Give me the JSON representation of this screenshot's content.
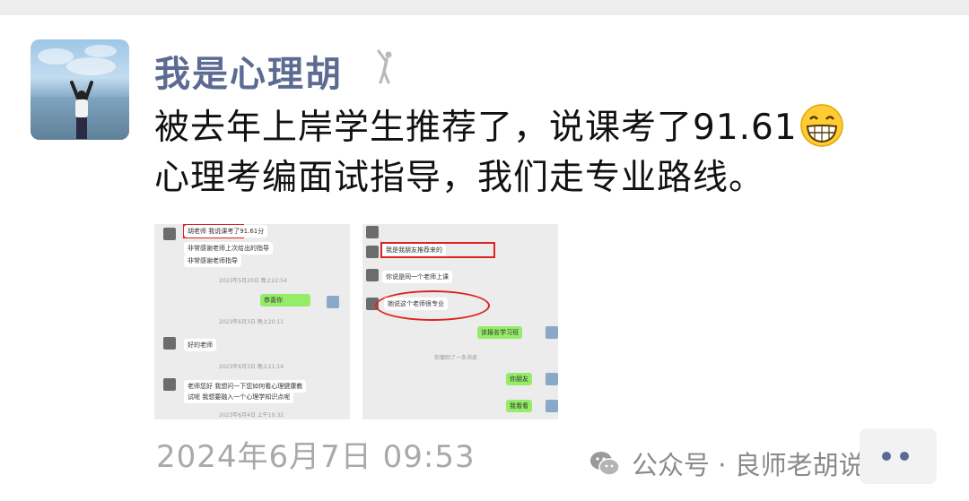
{
  "post": {
    "author_name": "我是心理胡",
    "author_badge_icon": "person-cheering-icon",
    "text_line1": "被去年上岸学生推荐了，说课考了91.61",
    "emoji": "grinning-face-emoji",
    "text_line2": "心理考编面试指导，我们走专业路线。",
    "timestamp": "2024年6月7日 09:53",
    "more_icon": "more-dots-icon"
  },
  "images": [
    {
      "name": "chat-screenshot-1",
      "messages": [
        {
          "side": "left",
          "text": "胡老师 我说课考了91.61分",
          "highlight": "box"
        },
        {
          "side": "left",
          "text": "非常感谢老师上次给出的指导"
        },
        {
          "side": "left",
          "text": "非常感谢老师指导"
        },
        {
          "side": "time",
          "text": "2023年5月20日 晚上22:54"
        },
        {
          "side": "right",
          "text": "恭喜你"
        },
        {
          "side": "time",
          "text": "2023年6月3日 晚上20:11"
        },
        {
          "side": "left",
          "text": "好的老师"
        },
        {
          "side": "time",
          "text": "2023年6月3日 晚上21:14"
        },
        {
          "side": "left",
          "text": "老师您好 我想问一下您如何看心理健康教"
        },
        {
          "side": "left",
          "text": "试呢 我想要融入一个心理学知识点呢"
        },
        {
          "side": "time",
          "text": "2023年6月4日 上午10:32"
        }
      ]
    },
    {
      "name": "chat-screenshot-2",
      "messages": [
        {
          "side": "left",
          "text": "我是我朋友推荐来的",
          "highlight": "box"
        },
        {
          "side": "left",
          "text": "你说是同一个老师上课"
        },
        {
          "side": "left",
          "text": "她说这个老师很专业",
          "highlight": "oval"
        },
        {
          "side": "right",
          "text": "该报名学习班"
        },
        {
          "side": "time",
          "text": "你撤回了一条消息"
        },
        {
          "side": "right",
          "text": "你朋友"
        },
        {
          "side": "right",
          "text": "我看看"
        }
      ]
    }
  ],
  "watermark": {
    "icon": "wechat-official-account-icon",
    "text": "公众号 · 良师老胡说心理"
  },
  "colors": {
    "author": "#5b6b92",
    "timestamp": "#a9a9a9",
    "green_bubble": "#95ec69",
    "highlight_red": "#d22222"
  }
}
